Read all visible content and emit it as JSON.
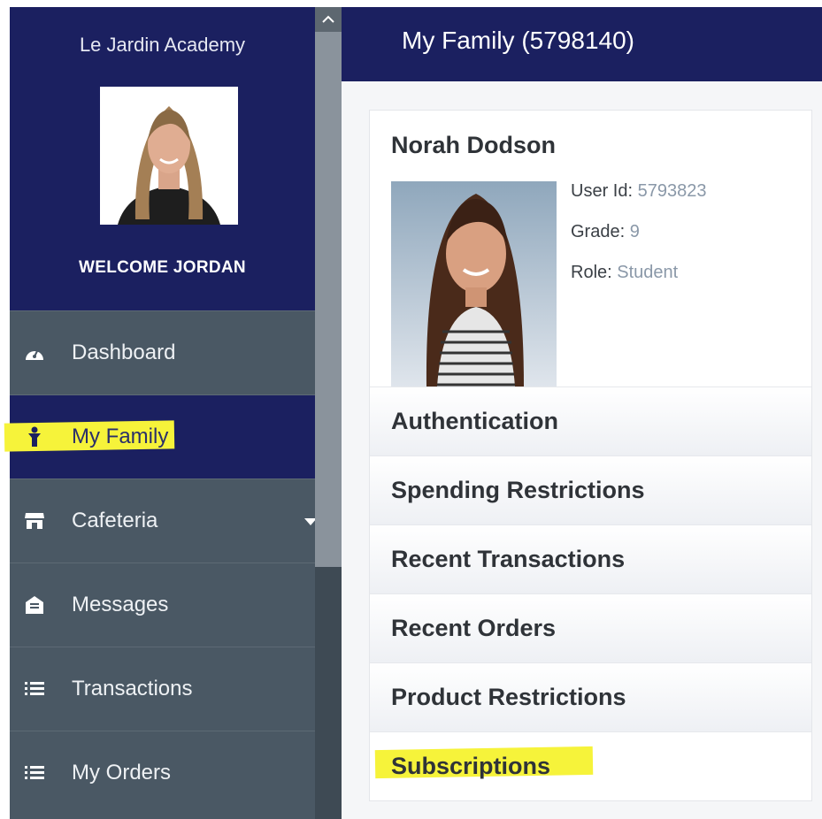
{
  "sidebar": {
    "school_name": "Le Jardin Academy",
    "welcome": "WELCOME JORDAN",
    "items": [
      {
        "label": "Dashboard",
        "icon": "dashboard-icon"
      },
      {
        "label": "My Family",
        "icon": "family-icon",
        "active": true
      },
      {
        "label": "Cafeteria",
        "icon": "store-icon"
      },
      {
        "label": "Messages",
        "icon": "envelope-icon"
      },
      {
        "label": "Transactions",
        "icon": "list-icon"
      },
      {
        "label": "My Orders",
        "icon": "list-icon"
      }
    ]
  },
  "header": {
    "title": "My Family (5798140)"
  },
  "student": {
    "name": "Norah Dodson",
    "user_id_label": "User Id:",
    "user_id": "5793823",
    "grade_label": "Grade:",
    "grade": "9",
    "role_label": "Role:",
    "role": "Student"
  },
  "sections": [
    {
      "label": "Authentication"
    },
    {
      "label": "Spending Restrictions"
    },
    {
      "label": "Recent Transactions"
    },
    {
      "label": "Recent Orders"
    },
    {
      "label": "Product Restrictions"
    },
    {
      "label": "Subscriptions"
    }
  ],
  "colors": {
    "navy": "#1b2060",
    "sidebar": "#4a5864",
    "highlight": "#f6f33a",
    "value": "#8a98a8"
  }
}
